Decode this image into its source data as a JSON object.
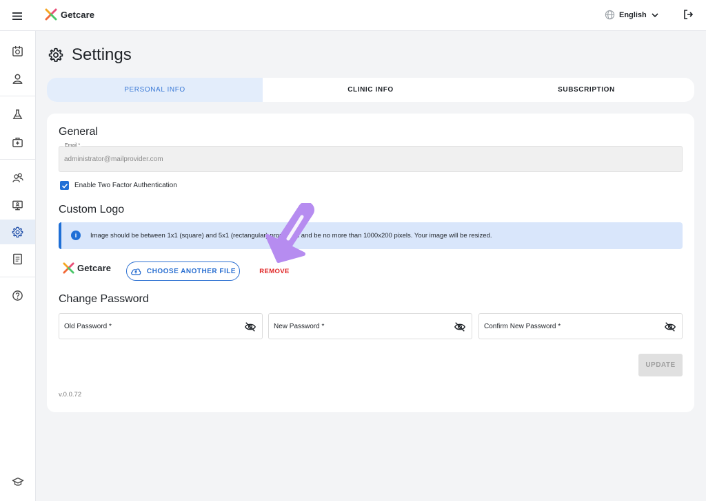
{
  "header": {
    "brand": "Getcare",
    "language": "English"
  },
  "sidebar": {
    "items": [
      {
        "icon": "calendar-icon"
      },
      {
        "icon": "user-icon"
      },
      {
        "icon": "lab-flask-icon"
      },
      {
        "icon": "medical-kit-icon"
      },
      {
        "icon": "team-icon"
      },
      {
        "icon": "monitor-icon"
      },
      {
        "icon": "gear-icon",
        "active": true
      },
      {
        "icon": "document-icon"
      },
      {
        "icon": "help-icon"
      },
      {
        "icon": "graduation-cap-icon"
      }
    ]
  },
  "page": {
    "title": "Settings"
  },
  "tabs": [
    {
      "label": "PERSONAL INFO",
      "active": true
    },
    {
      "label": "CLINIC INFO"
    },
    {
      "label": "SUBSCRIPTION"
    }
  ],
  "general": {
    "title": "General",
    "email_label": "Email *",
    "email_value": "administrator@mailprovider.com",
    "two_factor_label": "Enable Two Factor Authentication",
    "two_factor_checked": true
  },
  "custom_logo": {
    "title": "Custom Logo",
    "info_text": "Image should be between 1x1 (square) and 5x1 (rectangular) proportion and be no more than 1000x200 pixels. Your image will be resized.",
    "logo_text": "Getcare",
    "choose_label": "CHOOSE ANOTHER FILE",
    "remove_label": "REMOVE"
  },
  "password": {
    "title": "Change Password",
    "old_label": "Old Password *",
    "new_label": "New Password *",
    "confirm_label": "Confirm New Password *",
    "update_label": "UPDATE"
  },
  "version": "v.0.0.72",
  "colors": {
    "primary": "#1f6fd6",
    "danger": "#e02424",
    "tab_active_bg": "#e3edfb",
    "banner_bg": "#d9e6fb",
    "annotation_arrow": "#b68cf0"
  }
}
